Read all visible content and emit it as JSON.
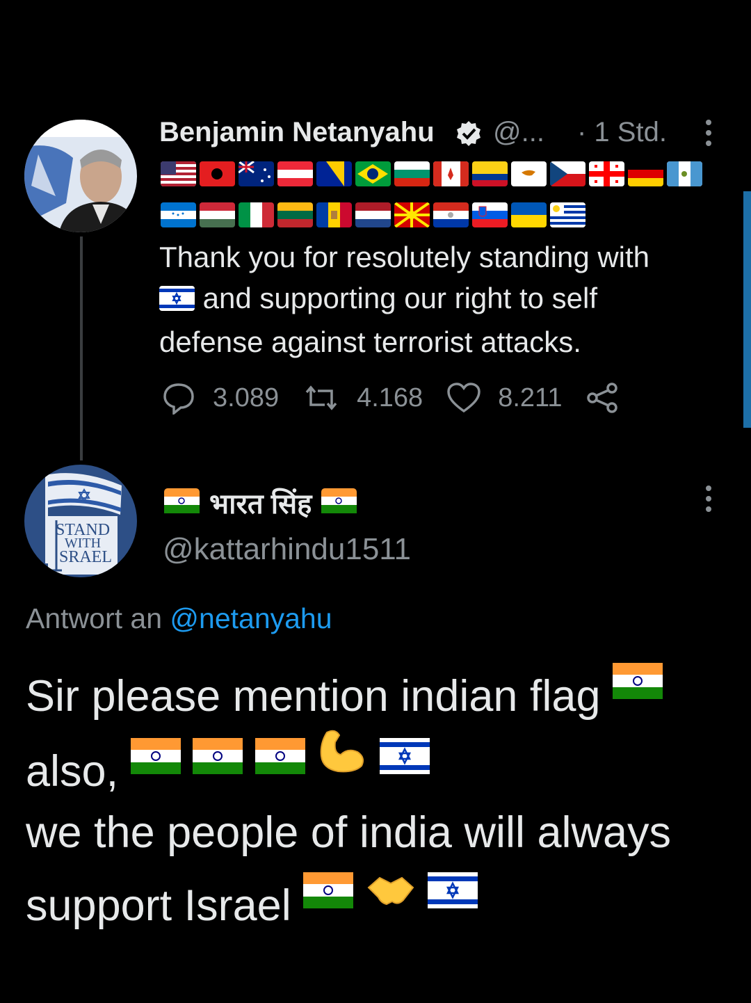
{
  "tweet": {
    "author_name": "Benjamin Netanyahu",
    "handle": "@...",
    "time": "· 1 Std.",
    "text_line1": "Thank you for resolutely standing with",
    "text_line2": "and supporting our right to self",
    "text_line3": "defense against terrorist attacks.",
    "flags_row1": [
      "us",
      "albania",
      "australia",
      "austria",
      "bosnia",
      "brazil",
      "bulgaria",
      "canada",
      "colombia",
      "cyprus",
      "czech",
      "georgia",
      "germany",
      "guatemala"
    ],
    "flags_row2": [
      "honduras",
      "hungary",
      "italy",
      "lithuania",
      "moldova",
      "netherlands",
      "north-macedonia",
      "paraguay",
      "slovenia",
      "ukraine",
      "uruguay"
    ],
    "stats": {
      "replies": "3.089",
      "retweets": "4.168",
      "likes": "8.211"
    }
  },
  "reply": {
    "author_name": "भारत सिंह",
    "handle": "@kattarhindu1511",
    "avatar_text": [
      "STAND",
      "WITH",
      "SRAEL"
    ],
    "reply_to_label": "Antwort an",
    "reply_to_mention": "@netanyahu",
    "line1": "Sir please mention indian flag",
    "line2": "also,",
    "line3": "we the people of india will always",
    "line4": "support Israel"
  },
  "colors": {
    "background": "#000000",
    "text": "#e7e9ea",
    "muted": "#8b9196",
    "accent": "#1d9bf0"
  }
}
